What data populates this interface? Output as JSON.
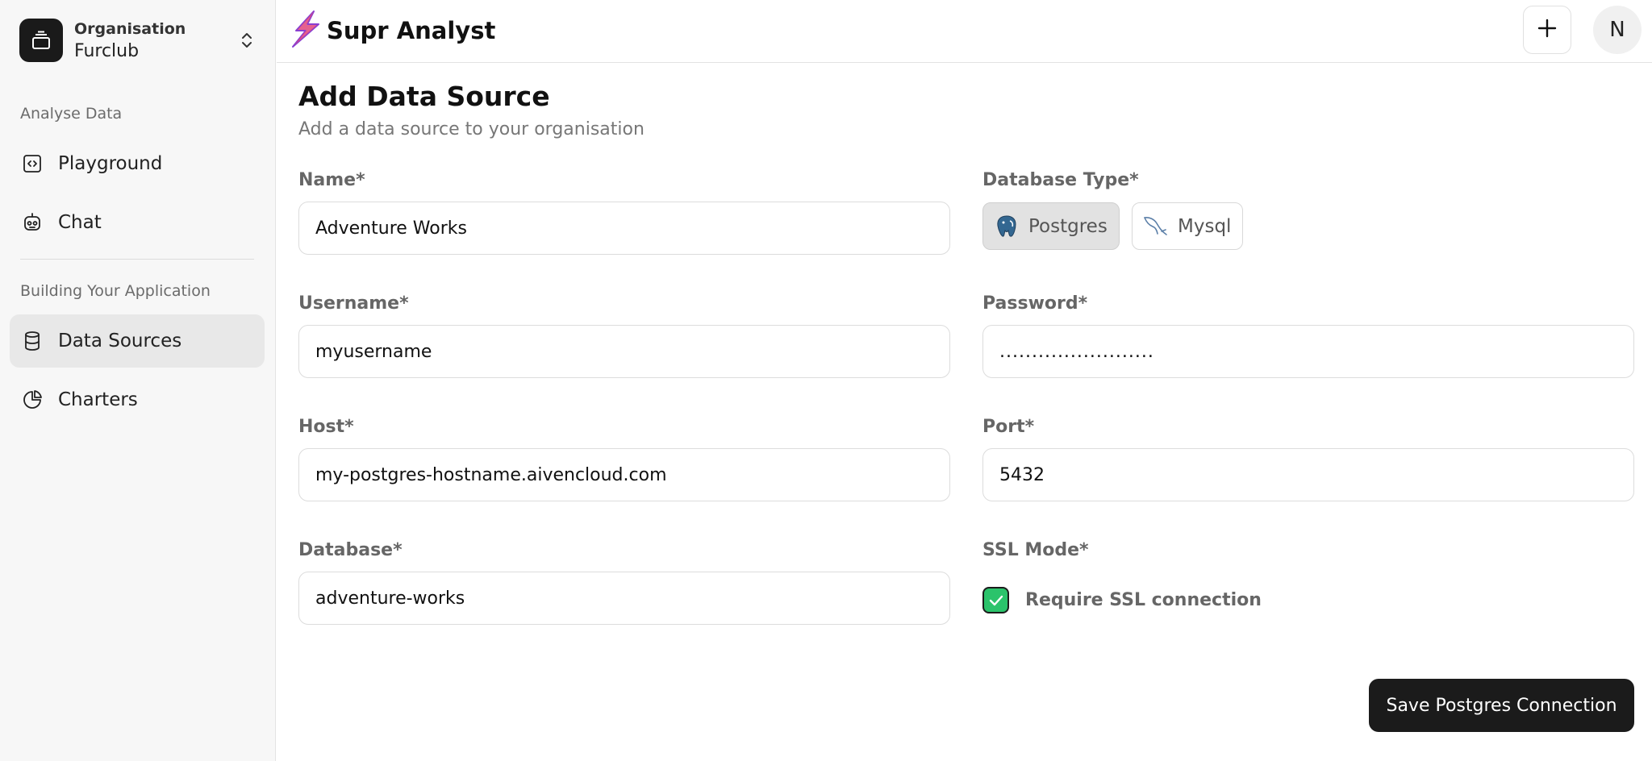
{
  "sidebar": {
    "org_label": "Organisation",
    "org_name": "Furclub",
    "section_analyse": "Analyse Data",
    "section_building": "Building Your Application",
    "items": [
      {
        "label": "Playground",
        "icon": "code-icon"
      },
      {
        "label": "Chat",
        "icon": "bot-icon"
      },
      {
        "label": "Data Sources",
        "icon": "database-icon",
        "active": true
      },
      {
        "label": "Charters",
        "icon": "pie-chart-icon"
      }
    ]
  },
  "header": {
    "brand": "Supr Analyst",
    "avatar_initial": "N"
  },
  "page": {
    "title": "Add Data Source",
    "subtitle": "Add a data source to your organisation"
  },
  "form": {
    "name_label": "Name*",
    "name_value": "Adventure Works",
    "dbtype_label": "Database Type*",
    "db_options": [
      "Postgres",
      "Mysql"
    ],
    "db_selected": "Postgres",
    "username_label": "Username*",
    "username_value": "myusername",
    "password_label": "Password*",
    "password_value": "........................",
    "host_label": "Host*",
    "host_value": "my-postgres-hostname.aivencloud.com",
    "port_label": "Port*",
    "port_value": "5432",
    "database_label": "Database*",
    "database_value": "adventure-works",
    "ssl_label": "SSL Mode*",
    "ssl_text": "Require SSL connection",
    "ssl_checked": true,
    "save_label": "Save Postgres Connection"
  },
  "colors": {
    "accent_check": "#2bc36b",
    "button_dark": "#1b1b1b",
    "logo_pink": "#e0457b",
    "logo_purple": "#8a3fd1"
  }
}
